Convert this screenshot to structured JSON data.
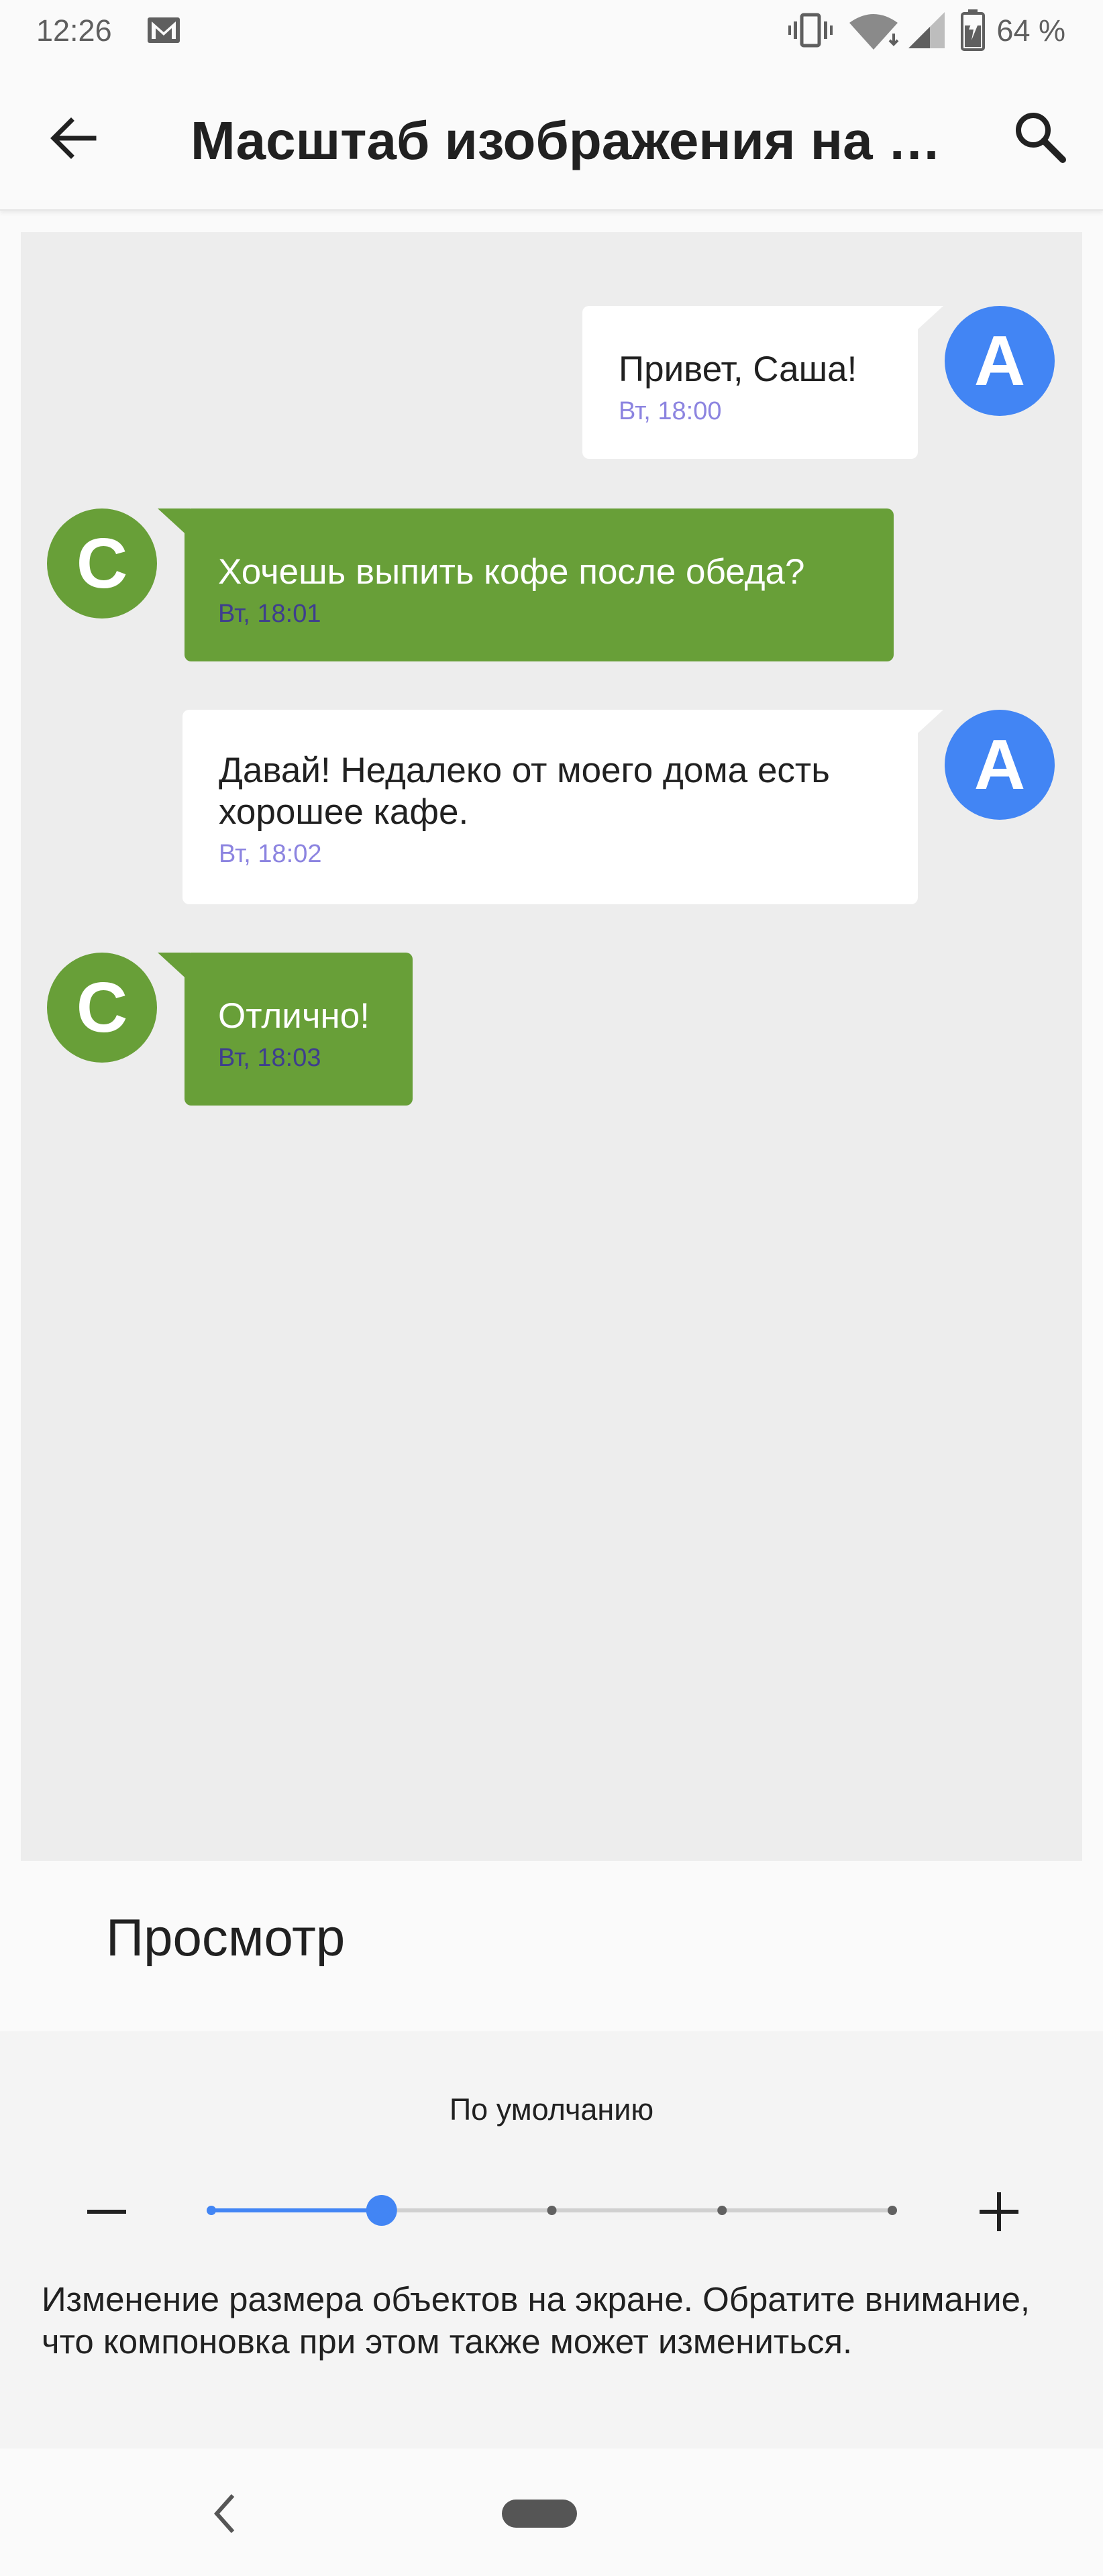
{
  "status_bar": {
    "time": "12:26",
    "battery": "64 %"
  },
  "app_bar": {
    "title": "Масштаб изображения на экране"
  },
  "chat": [
    {
      "sender": "A",
      "side": "right",
      "text": "Привет, Саша!",
      "time": "Вт, 18:00"
    },
    {
      "sender": "С",
      "side": "left",
      "text": "Хочешь выпить кофе после обеда?",
      "time": "Вт, 18:01"
    },
    {
      "sender": "A",
      "side": "right",
      "text": "Давай! Недалеко от моего дома есть хорошее кафе.",
      "time": "Вт, 18:02"
    },
    {
      "sender": "С",
      "side": "left",
      "text": "Отлично!",
      "time": "Вт, 18:03"
    }
  ],
  "preview_label": "Просмотр",
  "size_control": {
    "current_label": "По умолчанию",
    "selected_index": 1,
    "step_count": 5,
    "minus_symbol": "–",
    "plus_symbol": "+"
  },
  "description": "Изменение размера объектов на экране. Обратите внимание, что компоновка при этом также может измениться.",
  "colors": {
    "accent": "#4285f4",
    "green": "#689f38",
    "preview_bg": "#ededed"
  },
  "icons": [
    "gmail-icon",
    "vibrate-icon",
    "wifi-icon",
    "signal-icon",
    "battery-icon",
    "back-arrow-icon",
    "search-icon",
    "nav-back-icon",
    "home-pill-icon"
  ]
}
